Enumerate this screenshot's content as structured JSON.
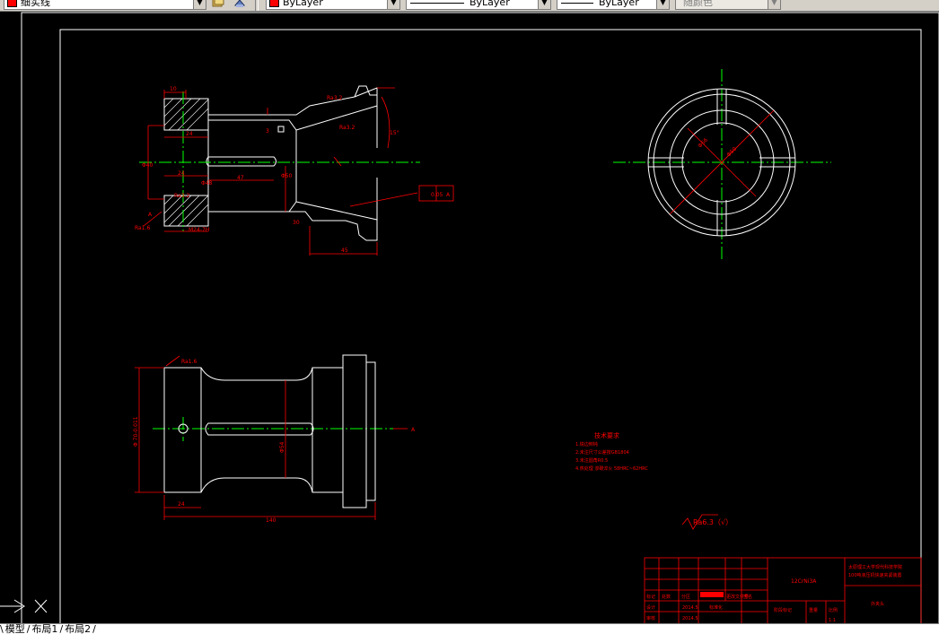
{
  "toolbar": {
    "layer_name": "细实线",
    "color_control": "ByLayer",
    "linetype_control": "ByLayer",
    "lineweight_control": "ByLayer",
    "plotstyle_control": "随颜色",
    "accent_color": "#ff0000"
  },
  "layout_tabs": {
    "model": "模型",
    "layout1": "布局1",
    "layout2": "布局2"
  },
  "drawing": {
    "dims_top": {
      "d10": "10",
      "ra32_top": "Ra3.2",
      "ra32_mid": "Ra3.2",
      "deg15": "15°",
      "m24": "24",
      "d3": "3",
      "d24": "24",
      "d47": "47",
      "phi50": "Φ50",
      "phi48": "Φ48",
      "ra32_left": "Ra3.2",
      "ra16_left": "Ra1.6",
      "phi40": "Φ40",
      "d45": "45",
      "d30": "30",
      "tol_value": "0.05",
      "tol_datum": "A",
      "datum_a": "A",
      "m24_lower": "M24-7H"
    },
    "dims_circle": {
      "phi66": "Φ66",
      "phi50": "Φ50"
    },
    "dims_bottom": {
      "ra16": "Ra1.6",
      "phi54": "Φ54",
      "phi70": "Φ 70-0.011",
      "d24": "24",
      "d140": "140",
      "section_a": "A"
    },
    "tech_req": {
      "title": "技术要求",
      "items": [
        "1.锐边倒钝",
        "2.未注尺寸公差按GB1804",
        "3.未注圆角R0.5",
        "4.热处理 渗碳淬火 58HRC~62HRC"
      ]
    },
    "roughness_note": "Ra6.3（√）",
    "title_block": {
      "material": "12CrNi3A",
      "school": "太原理工大学现代科技学院",
      "project": "100吨液压机快速夹紧装置",
      "part_name": "外夹头",
      "date1": "2014.5",
      "date2": "2014.5",
      "std": "标准化",
      "stage": "阶段标记",
      "weight": "重量",
      "scale_label": "比例",
      "scale": "1:1",
      "r_mark": "标记",
      "r_count": "处数",
      "r_zone": "分区",
      "r_doc": "更改文件号",
      "r_sign": "签名",
      "r_date": "年月日",
      "design": "设计",
      "check": "审核"
    }
  }
}
